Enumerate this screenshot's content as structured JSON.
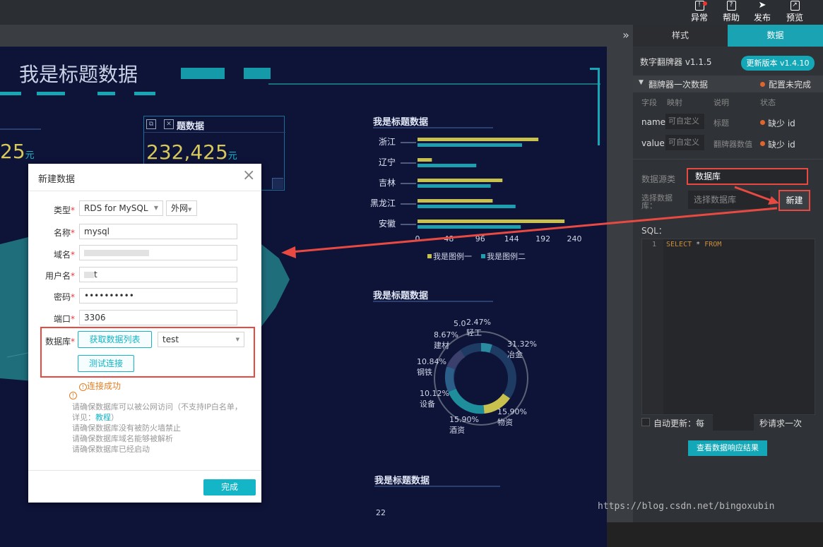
{
  "topbar": {
    "items": [
      {
        "label": "异常",
        "icon": "bell-alert-icon"
      },
      {
        "label": "帮助",
        "icon": "help-icon"
      },
      {
        "label": "发布",
        "icon": "send-icon"
      },
      {
        "label": "预览",
        "icon": "preview-icon"
      }
    ],
    "collapse_glyph": "»"
  },
  "canvas": {
    "main_title": "我是标题数据",
    "card_left": {
      "value_partial": "25",
      "unit": "元"
    },
    "card_right": {
      "title": "题数据",
      "value": "232,425",
      "unit": "元"
    },
    "bar_chart": {
      "title": "我是标题数据",
      "categories": [
        "浙江",
        "辽宁",
        "吉林",
        "黑龙江",
        "安徽"
      ],
      "ticks": [
        "0",
        "48",
        "96",
        "144",
        "192",
        "240"
      ],
      "legend": [
        "我是图例一",
        "我是图例二"
      ]
    },
    "ring_chart": {
      "title": "我是标题数据",
      "labels": [
        {
          "pct": "5.0",
          "name": ""
        },
        {
          "pct": "2.47%",
          "name": "轻工"
        },
        {
          "pct": "8.67%",
          "name": "建材"
        },
        {
          "pct": "31.32%",
          "name": "冶金"
        },
        {
          "pct": "10.84%",
          "name": "钢铁"
        },
        {
          "pct": "10.12%",
          "name": "设备"
        },
        {
          "pct": "15.90%",
          "name": "物资"
        },
        {
          "pct": "15.90%",
          "name": "酒资"
        }
      ]
    },
    "bottom_chart": {
      "title": "我是标题数据",
      "tick": "22"
    }
  },
  "modal": {
    "title": "新建数据",
    "close_glyph": "×",
    "fields": {
      "type": {
        "label": "类型",
        "value": "RDS for MySQL",
        "network": "外网"
      },
      "name": {
        "label": "名称",
        "value": "mysql"
      },
      "host": {
        "label": "域名",
        "value": ""
      },
      "user": {
        "label": "用户名",
        "value": "t"
      },
      "password": {
        "label": "密码",
        "value": "••••••••••"
      },
      "port": {
        "label": "端口",
        "value": "3306"
      },
      "database": {
        "label": "数据库",
        "fetch_button": "获取数据列表",
        "value": "test"
      }
    },
    "required_mark": "*",
    "test_button": "测试连接",
    "status": "连接成功",
    "tips": [
      "请确保数据库可以被公网访问（不支持IP白名单，",
      "详见：",
      "教程",
      "）",
      "请确保数据库没有被防火墙禁止",
      "请确保数据库域名能够被解析",
      "请确保数据库已经启动"
    ],
    "done_button": "完成"
  },
  "panel": {
    "tabs": [
      "样式",
      "数据"
    ],
    "component": "数字翻牌器 v1.1.5",
    "update_button": "更新版本 v1.4.10",
    "section_title": "翻牌器一次数据",
    "config_status": "配置未完成",
    "columns": [
      "字段",
      "映射",
      "说明",
      "状态"
    ],
    "rows": [
      {
        "field": "name",
        "map": "可自定义",
        "desc": "标题",
        "status": "缺少 id"
      },
      {
        "field": "value",
        "map": "可自定义",
        "desc": "翻牌器数值",
        "status": "缺少 id"
      }
    ],
    "datasource_label": "数据源类",
    "datasource_value": "数据库",
    "choose_label": "选择数据库：",
    "choose_placeholder": "选择数据库",
    "new_button": "新建",
    "sql_label": "SQL：",
    "sql_line_no": "1",
    "sql_keyword1": "SELECT",
    "sql_star": " * ",
    "sql_keyword2": "FROM",
    "auto_update": "自动更新：每",
    "auto_update_suffix": "秒请求一次",
    "view_result_button": "查看数据响应结果"
  },
  "watermark": "https://blog.csdn.net/bingoxubin",
  "colors": {
    "accent": "#14b5c6",
    "annotation": "#e84a42",
    "gold": "#d6c85a",
    "teal": "#1bb7c7"
  }
}
